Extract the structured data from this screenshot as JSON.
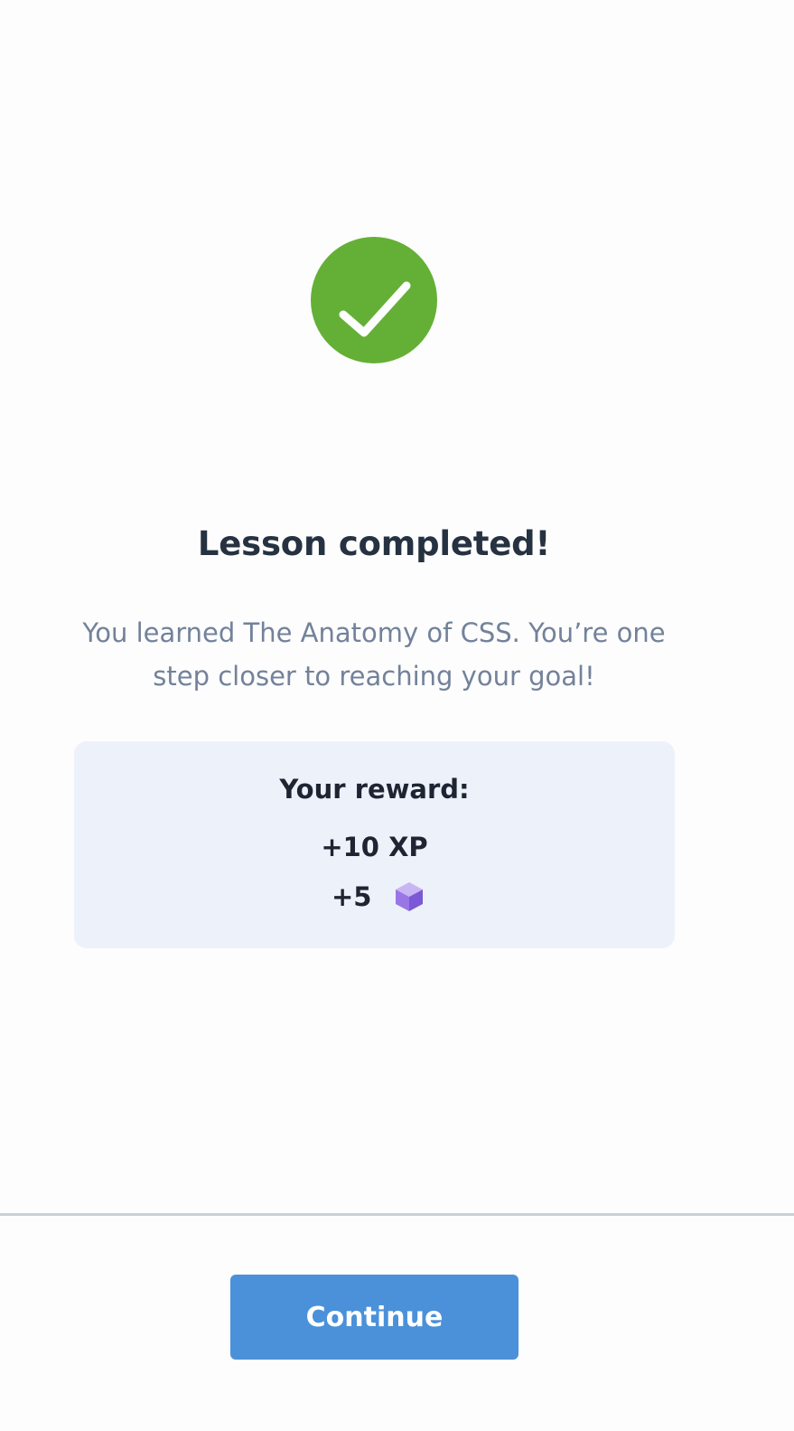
{
  "status": {
    "icon": "checkmark-icon",
    "color": "#64b036"
  },
  "title": "Lesson completed!",
  "message": "You learned The Anatomy of CSS. You’re one step closer to reaching your goal!",
  "reward": {
    "heading": "Your reward:",
    "xp": "+10 XP",
    "gems_value": "+5",
    "gems_icon": "gem-cube-icon",
    "card_color": "#edf1fa"
  },
  "footer": {
    "continue_label": "Continue",
    "button_color": "#4a91d9"
  }
}
